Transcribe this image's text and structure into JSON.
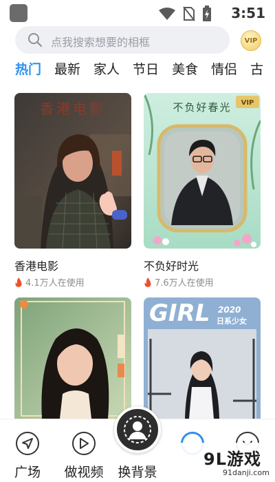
{
  "status_bar": {
    "time": "3:51"
  },
  "search": {
    "placeholder": "点我搜索想要的相框"
  },
  "vip_badge": "VIP",
  "tabs": [
    "热门",
    "最新",
    "家人",
    "节日",
    "美食",
    "情侣",
    "古"
  ],
  "active_tab": 0,
  "cards": [
    {
      "poster_text": "香港电影",
      "title": "香港电影",
      "usage": "4.1万人在使用"
    },
    {
      "poster_text": "不负好春光",
      "vip": "VIP",
      "title": "不负好时光",
      "usage": "7.6万人在使用"
    },
    {
      "poster_text": "",
      "title": "",
      "usage": ""
    },
    {
      "poster_text": "GIRL",
      "poster_year": "2020",
      "poster_sub": "日系少女",
      "title": "",
      "usage": ""
    }
  ],
  "bottom_nav": {
    "plaza": "广场",
    "make_video": "做视频",
    "change_bg": "换背景"
  },
  "watermark": {
    "logo": "9L游戏",
    "url": "91danji.com"
  },
  "colors": {
    "accent": "#2f8ff0",
    "fire": "#f0502d"
  }
}
